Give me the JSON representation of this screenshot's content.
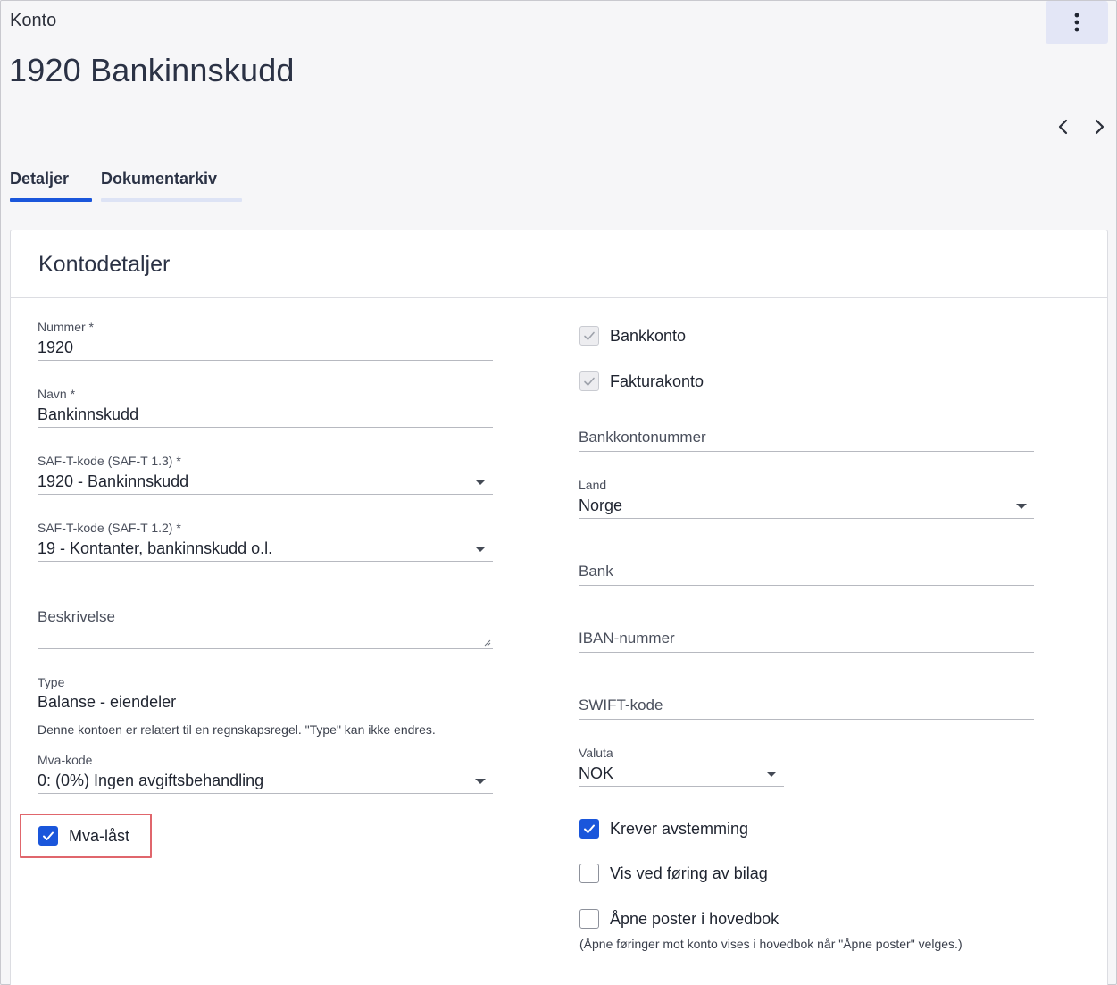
{
  "header": {
    "breadcrumb": "Konto",
    "title": "1920 Bankinnskudd"
  },
  "tabs": [
    {
      "label": "Detaljer",
      "active": true
    },
    {
      "label": "Dokumentarkiv",
      "active": false
    }
  ],
  "card": {
    "title": "Kontodetaljer"
  },
  "left": {
    "nummer": {
      "label": "Nummer *",
      "value": "1920"
    },
    "navn": {
      "label": "Navn *",
      "value": "Bankinnskudd"
    },
    "saft13": {
      "label": "SAF-T-kode (SAF-T 1.3) *",
      "value": "1920 - Bankinnskudd"
    },
    "saft12": {
      "label": "SAF-T-kode (SAF-T 1.2) *",
      "value": "19 - Kontanter, bankinnskudd o.l."
    },
    "beskrivelse": {
      "placeholder": "Beskrivelse"
    },
    "type": {
      "label": "Type",
      "value": "Balanse - eiendeler",
      "note": "Denne kontoen er relatert til en regnskapsregel. \"Type\" kan ikke endres."
    },
    "mva": {
      "label": "Mva-kode",
      "value": "0: (0%) Ingen avgiftsbehandling"
    },
    "mva_last": {
      "label": "Mva-låst",
      "checked": true
    }
  },
  "right": {
    "bankkonto": {
      "label": "Bankkonto",
      "checked": true
    },
    "fakturakonto": {
      "label": "Fakturakonto",
      "checked": true
    },
    "bankkontonummer": {
      "placeholder": "Bankkontonummer"
    },
    "land": {
      "label": "Land",
      "value": "Norge"
    },
    "bank": {
      "placeholder": "Bank"
    },
    "iban": {
      "placeholder": "IBAN-nummer"
    },
    "swift": {
      "placeholder": "SWIFT-kode"
    },
    "valuta": {
      "label": "Valuta",
      "value": "NOK"
    },
    "krever_avstemming": {
      "label": "Krever avstemming",
      "checked": true
    },
    "vis_ved_foring": {
      "label": "Vis ved føring av bilag",
      "checked": false
    },
    "apne_poster": {
      "label": "Åpne poster i hovedbok",
      "checked": false,
      "note": "(Åpne føringer mot konto vises i hovedbok når \"Åpne poster\" velges.)"
    }
  },
  "colors": {
    "accent": "#1a56db",
    "tab_inactive_underline": "#dde3f5",
    "highlight": "#e0666c",
    "more_button_bg": "#e3e6f6"
  },
  "icons": {
    "more": "kebab-vertical-icon",
    "prev": "chevron-left-icon",
    "next": "chevron-right-icon",
    "check": "check-icon",
    "dropdown": "caret-down-icon"
  }
}
